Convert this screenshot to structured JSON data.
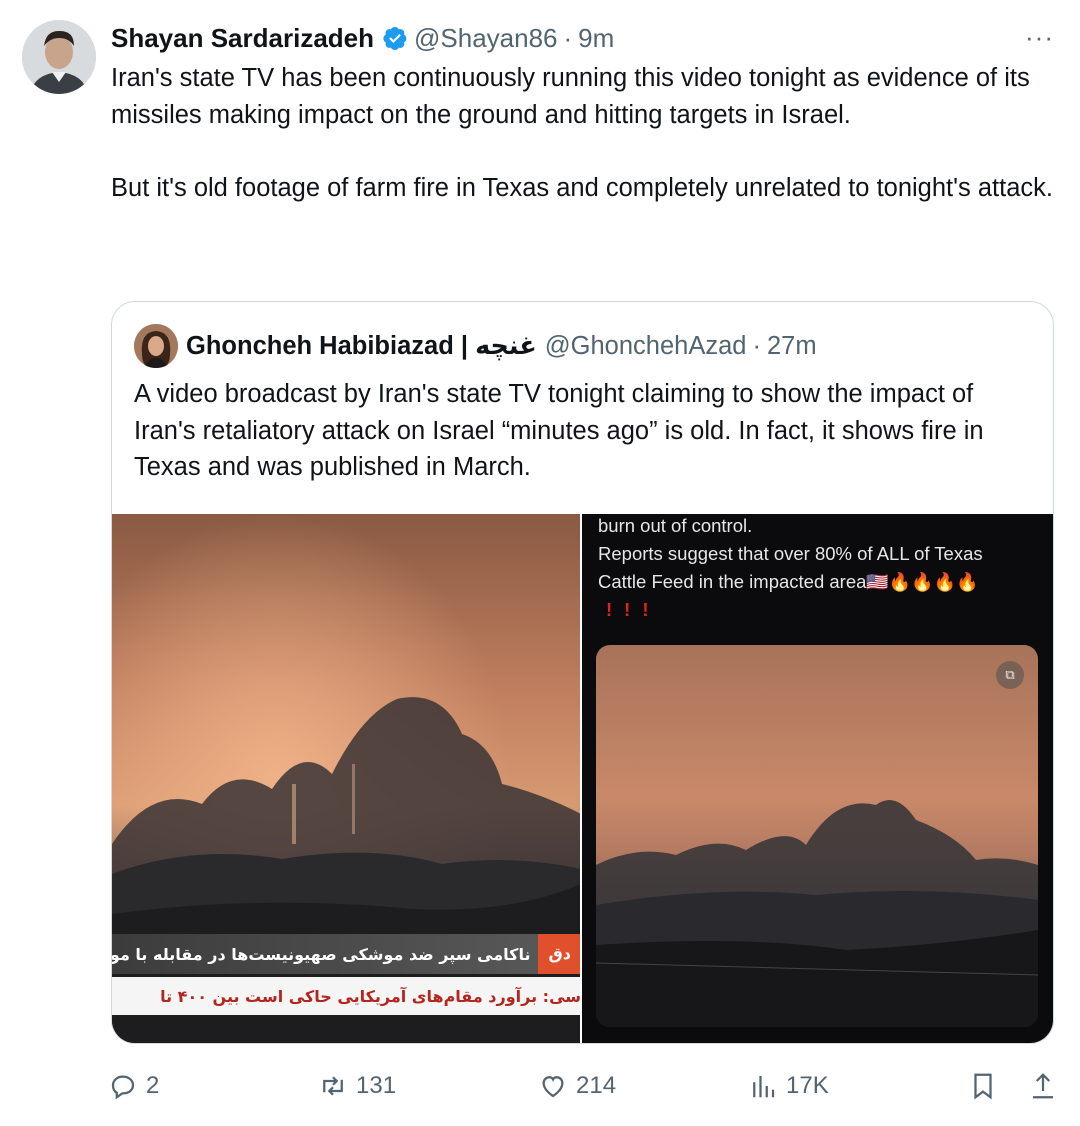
{
  "tweet": {
    "author_name": "Shayan Sardarizadeh",
    "author_handle": "@Shayan86",
    "separator": "·",
    "time": "9m",
    "paragraph1": "Iran's state TV has been continuously running this video tonight as evidence of its missiles making impact on the ground and hitting targets in Israel.",
    "paragraph2": "But it's old footage of farm fire in Texas and completely unrelated to tonight's attack.",
    "more_label": "···"
  },
  "quote": {
    "author_name": "Ghoncheh Habibiazad | غنچه",
    "author_handle": "@GhonchehAzad",
    "separator": "·",
    "time": "27m",
    "text": "A video broadcast by Iran's state TV tonight claiming to show the impact of Iran's retaliatory attack on Israel “minutes ago” is old. In fact, it shows fire in Texas and was published in March."
  },
  "media": {
    "left": {
      "ticker_tag": "دق",
      "ticker_line1": "ناکامی سپر ضد موشکی صهیونیست‌ها در مقابله با موشک",
      "ticker_line2": "سی: برآورد مقام‌های آمریکایی حاکی است بین ۴۰۰ تا"
    },
    "right": {
      "caption_line1": "burn out of control.",
      "caption_line2": "Reports suggest that over 80% of ALL of Texas",
      "caption_line3": "Cattle Feed in the impacted area",
      "caption_emoji": "🇺🇸🔥🔥🔥🔥",
      "caption_bangs": "!!!",
      "badge": "⧉"
    }
  },
  "actions": {
    "replies": "2",
    "retweets": "131",
    "likes": "214",
    "views": "17K"
  },
  "colors": {
    "text_primary": "#0f1419",
    "text_secondary": "#536471",
    "verified_blue": "#1d9bf0",
    "border": "#cfd9de"
  }
}
